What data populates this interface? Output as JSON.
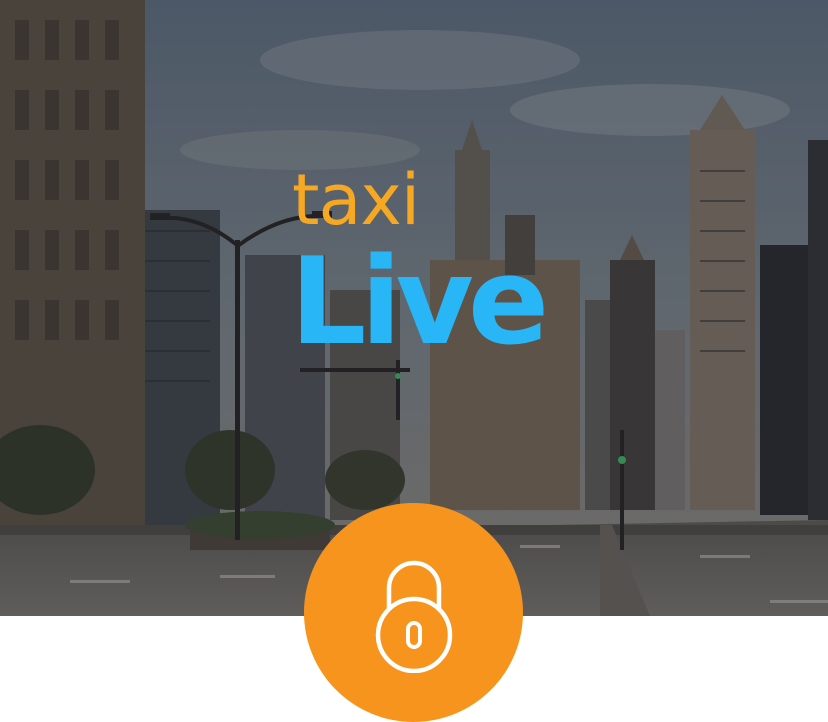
{
  "logo": {
    "line1": "taxi",
    "line2": "Live",
    "line1_color": "#F7A823",
    "line2_color": "#29B6F6"
  },
  "lock_badge": {
    "icon": "padlock-icon",
    "bg_color": "#F7941D",
    "icon_color": "#FFFFFF"
  },
  "hero": {
    "image": "city-street-background"
  }
}
